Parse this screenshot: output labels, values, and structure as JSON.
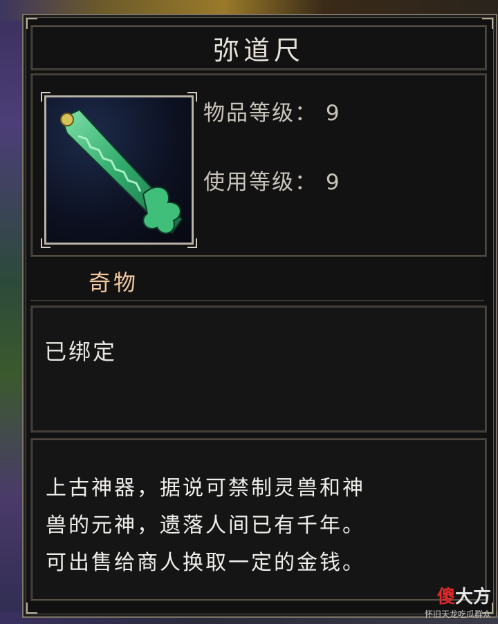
{
  "item": {
    "name": "弥道尺",
    "icon": "jade-ruler-weapon-icon",
    "item_level_label": "物品等级：",
    "item_level": "9",
    "use_level_label": "使用等级：",
    "use_level": "9",
    "category": "奇物",
    "bind_status": "已绑定",
    "description_lines": [
      "上古神器，据说可禁制灵兽和神",
      "兽的元神，遗落人间已有千年。",
      "可出售给商人换取一定的金钱。"
    ]
  },
  "watermark": {
    "brand_red": "傻",
    "brand_rest": "大方",
    "sub": "怀旧天龙吃瓜群众"
  },
  "colors": {
    "panel_bg": "#111111",
    "border": "#7c7466",
    "title_text": "#e7e3dc",
    "stat_text": "#c9c4bb",
    "category_text": "#efc8a0",
    "body_text": "#f0eeea"
  }
}
